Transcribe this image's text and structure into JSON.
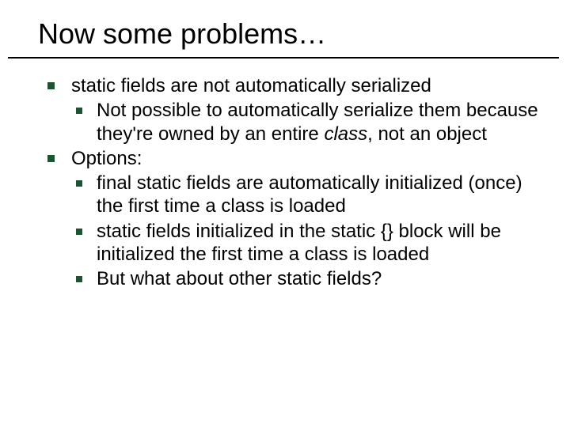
{
  "title": "Now some problems…",
  "b1": "static fields are not automatically serialized",
  "b1_1_pre": "Not possible to automatically serialize them because they're owned by an entire ",
  "b1_1_em": "class",
  "b1_1_post": ", not an object",
  "b2": "Options:",
  "b2_1": "final static fields are automatically initialized (once) the first time a class is loaded",
  "b2_2": "static fields initialized in the static {} block will be initialized the first time a class is loaded",
  "b2_3": "But what about other static fields?"
}
